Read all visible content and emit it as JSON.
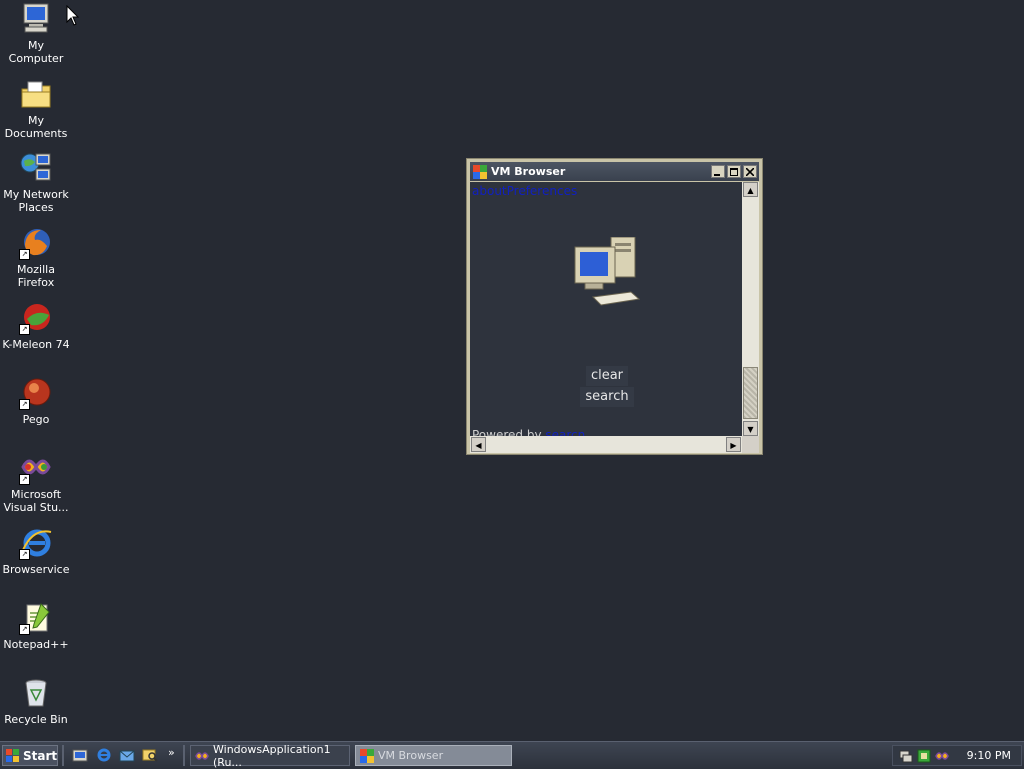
{
  "desktop": {
    "icons": [
      {
        "label_line1": "My Computer",
        "label_line2": ""
      },
      {
        "label_line1": "My Documents",
        "label_line2": ""
      },
      {
        "label_line1": "My Network",
        "label_line2": "Places"
      },
      {
        "label_line1": "Mozilla Firefox",
        "label_line2": ""
      },
      {
        "label_line1": "K-Meleon 74",
        "label_line2": ""
      },
      {
        "label_line1": "Pego",
        "label_line2": ""
      },
      {
        "label_line1": "Microsoft",
        "label_line2": "Visual Stu..."
      },
      {
        "label_line1": "Browservice",
        "label_line2": ""
      },
      {
        "label_line1": "Notepad++",
        "label_line2": ""
      },
      {
        "label_line1": "Recycle Bin",
        "label_line2": ""
      }
    ],
    "background_color": "#262a33"
  },
  "window": {
    "title": "VM Browser",
    "content": {
      "top_links": "aboutPreferences",
      "clear_button": "clear",
      "search_button": "search",
      "powered_by_text": "Powered by",
      "powered_by_link": "searcn"
    },
    "vertical_scroll_position": 0.77
  },
  "taskbar": {
    "start_label": "Start",
    "tasks": [
      {
        "label": "WindowsApplication1 (Ru..."
      },
      {
        "label": "VM Browser"
      }
    ],
    "clock": "9:10 PM",
    "overflow_glyph": "»"
  }
}
